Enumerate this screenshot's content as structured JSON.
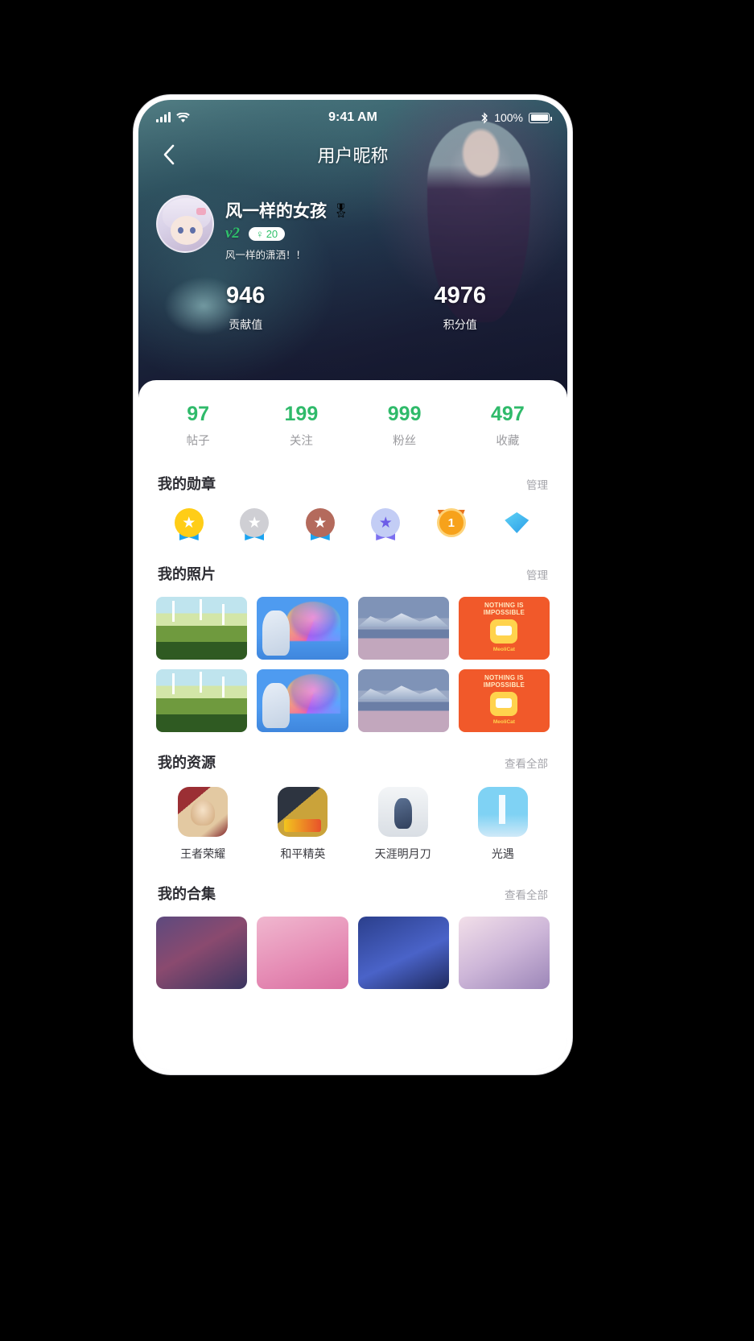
{
  "status_bar": {
    "time": "9:41 AM",
    "battery_percent": "100%",
    "signal_icon": "signal-bars-icon",
    "wifi_icon": "wifi-icon",
    "bluetooth_icon": "bluetooth-icon",
    "battery_icon": "battery-full-icon"
  },
  "nav": {
    "title": "用户昵称",
    "back_icon": "chevron-left-icon"
  },
  "profile": {
    "avatar_icon": "user-avatar",
    "username": "风一样的女孩",
    "medal_emoji": "🎖",
    "level": "v2",
    "gender_icon": "♀",
    "age": "20",
    "signature": "风一样的潇洒！！"
  },
  "hero_stats": [
    {
      "value": "946",
      "label": "贡献值"
    },
    {
      "value": "4976",
      "label": "积分值"
    }
  ],
  "counts": [
    {
      "value": "97",
      "label": "帖子"
    },
    {
      "value": "199",
      "label": "关注"
    },
    {
      "value": "999",
      "label": "粉丝"
    },
    {
      "value": "497",
      "label": "收藏"
    }
  ],
  "badges_section": {
    "title": "我的勋章",
    "action": "管理",
    "items": [
      {
        "name": "gold-star-medal-badge",
        "glyph": "★"
      },
      {
        "name": "silver-star-medal-badge",
        "glyph": "★"
      },
      {
        "name": "bronze-star-medal-badge",
        "glyph": "★"
      },
      {
        "name": "purple-star-medal-badge",
        "glyph": "★"
      },
      {
        "name": "rank-one-medal-badge",
        "glyph": "1"
      },
      {
        "name": "diamond-badge",
        "glyph": ""
      }
    ]
  },
  "photos_section": {
    "title": "我的照片",
    "action": "管理",
    "rows": [
      [
        {
          "name": "photo-windmill-field"
        },
        {
          "name": "photo-rainbow-neon"
        },
        {
          "name": "photo-snow-mountain"
        },
        {
          "name": "photo-nothing-impossible"
        }
      ],
      [
        {
          "name": "photo-windmill-field"
        },
        {
          "name": "photo-rainbow-neon"
        },
        {
          "name": "photo-snow-mountain"
        },
        {
          "name": "photo-nothing-impossible"
        }
      ]
    ],
    "cat_poster": {
      "line1": "NOTHING IS",
      "line2": "IMPOSSIBLE",
      "brand": "MeoliCat"
    }
  },
  "resources_section": {
    "title": "我的资源",
    "action": "查看全部",
    "items": [
      {
        "name": "王者荣耀"
      },
      {
        "name": "和平精英"
      },
      {
        "name": "天涯明月刀"
      },
      {
        "name": "光遇"
      }
    ]
  },
  "collections_section": {
    "title": "我的合集",
    "action": "查看全部",
    "items": [
      {
        "name": "collection-fantasy"
      },
      {
        "name": "collection-pink"
      },
      {
        "name": "collection-blue"
      },
      {
        "name": "collection-anime"
      }
    ]
  },
  "colors": {
    "accent_green": "#2fba6a",
    "brand_orange": "#f1592a",
    "muted": "#9b9b9f"
  }
}
